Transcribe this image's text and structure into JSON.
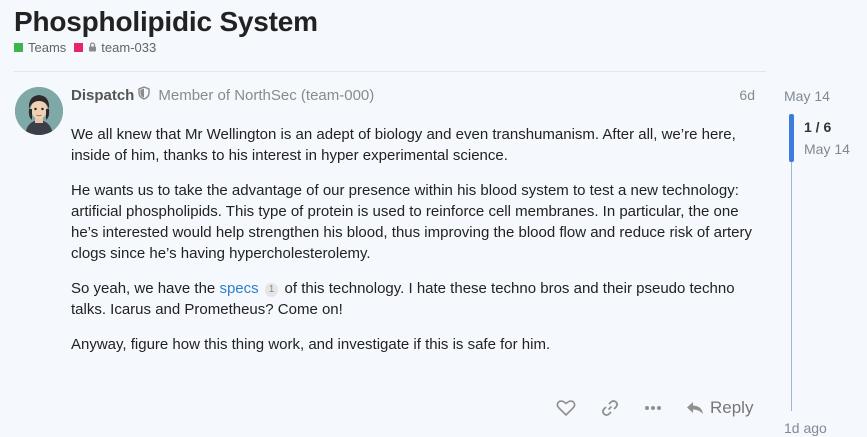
{
  "topic": {
    "title": "Phospholipidic System",
    "categories": [
      {
        "label": "Teams",
        "color": "#3cb54a"
      },
      {
        "label": "team-033",
        "color": "#e8246d",
        "locked": true
      }
    ]
  },
  "post": {
    "username": "Dispatch",
    "user_title": "Member of NorthSec (team-000)",
    "age": "6d",
    "paragraphs": {
      "p1": "We all knew that Mr Wellington is an adept of biology and even transhumanism. After all, we’re here, inside of him, thanks to his interest in hyper experimental science.",
      "p2": "He wants us to take the advantage of our presence within his blood system to test a new technology: artificial phospholipids. This type of protein is used to reinforce cell membranes. In particular, the one he’s interested would help strengthen his blood, thus improving the blood flow and reduce risk of artery clogs since he’s having hypercholesterolemy.",
      "p3_before": "So yeah, we have the ",
      "p3_link": "specs",
      "p3_badge": "1",
      "p3_after": " of this technology. I hate these techno bros and their pseudo techno talks. Icarus and Prometheus? Come on!",
      "p4": "Anyway, figure how this thing work, and investigate if this is safe for him."
    },
    "actions": {
      "reply_label": "Reply"
    }
  },
  "timeline": {
    "top_date": "May 14",
    "position": "1 / 6",
    "current_date": "May 14",
    "bottom_label": "1d ago"
  }
}
